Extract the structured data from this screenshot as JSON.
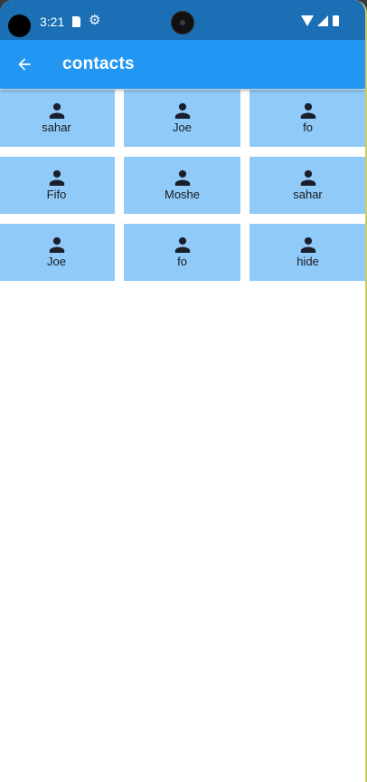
{
  "status_bar": {
    "time": "3:21",
    "icons": [
      "sd-card-icon",
      "settings-icon",
      "wifi-icon",
      "signal-icon",
      "battery-icon"
    ],
    "color": "#1a6fb5"
  },
  "app_bar": {
    "title": "contacts",
    "back_icon": "arrow-back-icon",
    "color": "#2196f3"
  },
  "contacts": {
    "tile_color": "#90caf9",
    "icon": "person-icon",
    "items": [
      {
        "name": "sahar"
      },
      {
        "name": "Joe"
      },
      {
        "name": "fo"
      },
      {
        "name": "Fifo"
      },
      {
        "name": "Moshe"
      },
      {
        "name": "sahar"
      },
      {
        "name": "Joe"
      },
      {
        "name": "fo"
      },
      {
        "name": "hide"
      }
    ]
  }
}
